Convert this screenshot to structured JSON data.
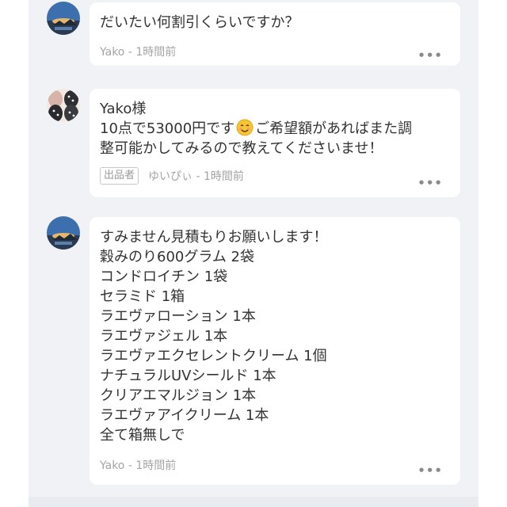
{
  "comments": [
    {
      "text": "だいたい何割引くらいですか？",
      "meta": "Yako - 1時間前",
      "more": "•••"
    },
    {
      "line1": "Yako様",
      "line2_before": "10点で53000円です",
      "line2_after": "ご希望額があればまた調",
      "line3": "整可能かしてみるので教えてくださいませ！",
      "badge": "出品者",
      "meta": "ゆいぴぃ - 1時間前",
      "more": "•••"
    },
    {
      "lines": [
        "すみません見積もりお願いします！",
        "穀みのり600グラム 2袋",
        "コンドロイチン 1袋",
        "セラミド 1箱",
        "ラエヴァローション 1本",
        "ラエヴァジェル 1本",
        "ラエヴァエクセレントクリーム 1個",
        "ナチュラルUVシールド 1本",
        "クリアエマルジョン 1本",
        "ラエヴァアイクリーム 1本",
        "全て箱無しで"
      ],
      "meta": "Yako - 1時間前",
      "more": "•••"
    }
  ],
  "icons": {
    "emoji": "smiling-face-emoji",
    "more": "more-dots-icon",
    "avatar_buyer": "mountain-sunset-avatar",
    "avatar_seller": "pattern-avatar"
  }
}
